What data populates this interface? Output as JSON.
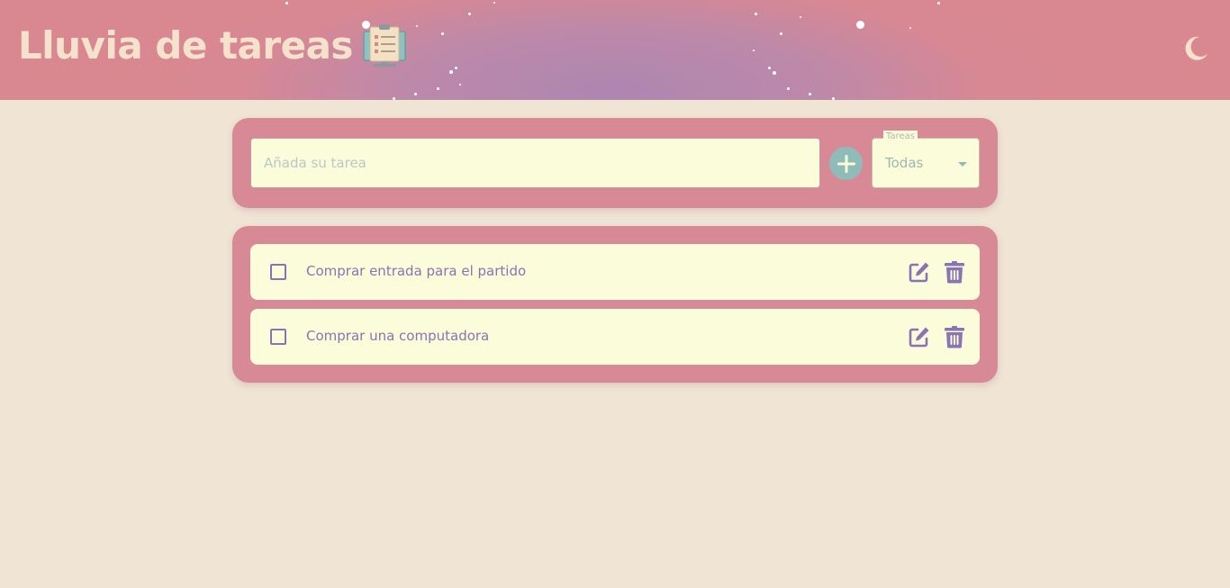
{
  "header": {
    "title": "Lluvia de tareas",
    "title_icon": "clipboard-list-icon",
    "theme_toggle_icon": "moon-icon",
    "gradient_colors": [
      "#d88893",
      "#ae86b1"
    ]
  },
  "add_task": {
    "input_placeholder": "Añada su tarea",
    "input_value": "",
    "add_button_icon": "plus-icon",
    "filter": {
      "legend": "Tareas",
      "selected": "Todas"
    }
  },
  "tasks": [
    {
      "text": "Comprar entrada para el partido",
      "completed": false
    },
    {
      "text": "Comprar una computadora",
      "completed": false
    }
  ],
  "task_actions": {
    "edit_icon": "edit-icon",
    "delete_icon": "trash-icon"
  },
  "colors": {
    "background": "#f0e4d5",
    "card": "#d78995",
    "field": "#fbfcd9",
    "accent_purple": "#8a73b4",
    "accent_teal": "#8fbcb9"
  }
}
